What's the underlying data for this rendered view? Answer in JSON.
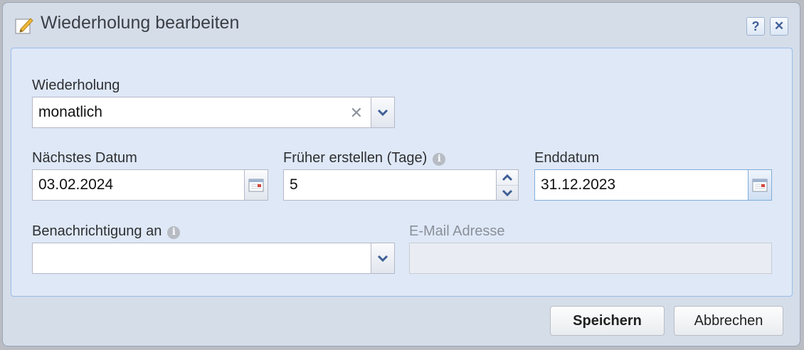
{
  "window": {
    "title": "Wiederholung bearbeiten",
    "title_icon": "edit-pencil-icon",
    "help_label": "?",
    "close_label": "✕"
  },
  "form": {
    "recurrence": {
      "label": "Wiederholung",
      "value": "monatlich",
      "clear_glyph": "✕"
    },
    "next_date": {
      "label": "Nächstes Datum",
      "value": "03.02.2024"
    },
    "create_earlier": {
      "label": "Früher erstellen (Tage)",
      "value": "5",
      "info": "i"
    },
    "end_date": {
      "label": "Enddatum",
      "value": "31.12.2023"
    },
    "notification": {
      "label": "Benachrichtigung an",
      "value": "",
      "info": "i"
    },
    "email": {
      "label": "E-Mail Adresse",
      "value": "",
      "disabled": true
    }
  },
  "buttons": {
    "save": "Speichern",
    "cancel": "Abbrechen"
  },
  "colors": {
    "accent": "#3f5f95",
    "panel_bg": "#dfe8f6",
    "window_bg": "#d5dde9"
  }
}
